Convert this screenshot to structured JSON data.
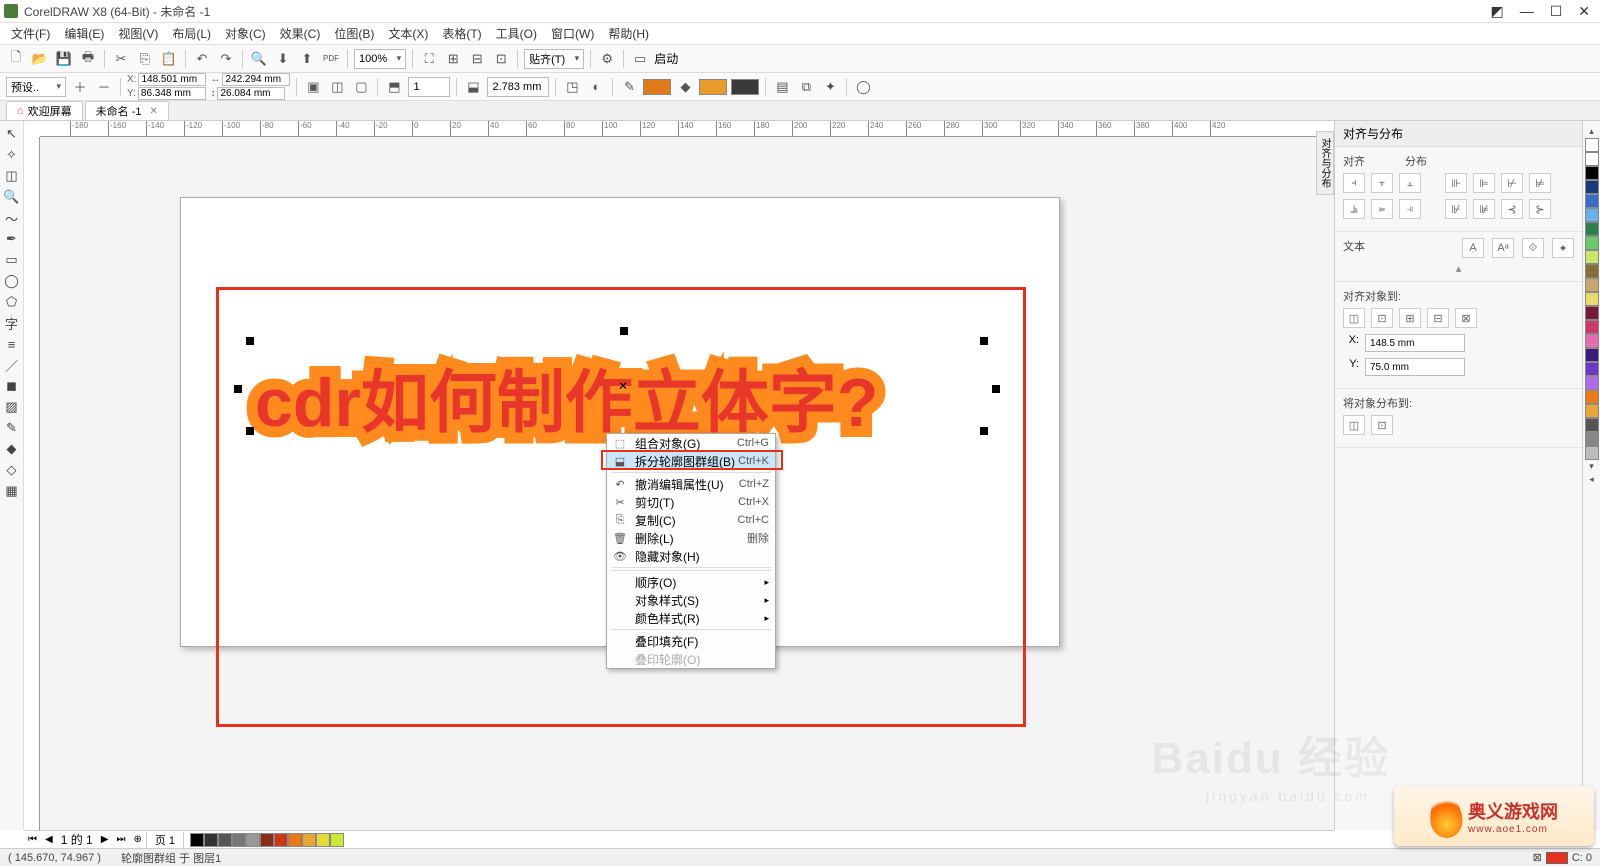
{
  "window": {
    "title": "CorelDRAW X8 (64-Bit) - 未命名 -1"
  },
  "menu": [
    "文件(F)",
    "编辑(E)",
    "视图(V)",
    "布局(L)",
    "对象(C)",
    "效果(C)",
    "位图(B)",
    "文本(X)",
    "表格(T)",
    "工具(O)",
    "窗口(W)",
    "帮助(H)"
  ],
  "toolbar1": {
    "zoom": "100%",
    "snap": "贴齐(T)",
    "launch": "启动"
  },
  "toolbar2": {
    "preset": "预设..",
    "x": "148.501 mm",
    "y": "86.348 mm",
    "w": "242.294 mm",
    "h": "26.084 mm",
    "units_val": "1",
    "outline_width": "2.783 mm",
    "fill_color": "#e07a1a",
    "fill_color2": "#e89a2a",
    "outline_color": "#3a3a3a"
  },
  "tabs": {
    "welcome": "欢迎屏幕",
    "doc": "未命名 -1"
  },
  "ruler_marks": [
    -180,
    -160,
    -140,
    -120,
    -100,
    -80,
    -60,
    -40,
    -20,
    0,
    20,
    40,
    60,
    80,
    100,
    120,
    140,
    160,
    180,
    200,
    220,
    240,
    260,
    280,
    300,
    320,
    340,
    360,
    380,
    400,
    420
  ],
  "art_text": "cdr如何制作立体字?",
  "context_menu": {
    "items": [
      {
        "icon": "⬚",
        "label": "组合对象(G)",
        "shortcut": "Ctrl+G"
      },
      {
        "icon": "⬓",
        "label": "拆分轮廓图群组(B)",
        "shortcut": "Ctrl+K",
        "selected": true
      },
      {
        "icon": "↶",
        "label": "撤消编辑属性(U)",
        "shortcut": "Ctrl+Z"
      },
      {
        "icon": "✂",
        "label": "剪切(T)",
        "shortcut": "Ctrl+X"
      },
      {
        "icon": "⎘",
        "label": "复制(C)",
        "shortcut": "Ctrl+C"
      },
      {
        "icon": "🗑",
        "label": "删除(L)",
        "shortcut": "删除"
      },
      {
        "icon": "👁",
        "label": "隐藏对象(H)",
        "shortcut": ""
      },
      {
        "label": "顺序(O)",
        "submenu": true
      },
      {
        "label": "对象样式(S)",
        "submenu": true
      },
      {
        "label": "颜色样式(R)",
        "submenu": true
      },
      {
        "label": "叠印填充(F)"
      },
      {
        "label": "叠印轮廓(O)",
        "disabled": true
      }
    ]
  },
  "docker": {
    "title": "对齐与分布",
    "sec_align": "对齐",
    "sec_distribute": "分布",
    "sec_text": "文本",
    "sec_align_to": "对齐对象到:",
    "x_val": "148.5 mm",
    "y_val": "75.0 mm",
    "sec_dist_to": "将对象分布到:",
    "vtab": "对齐与分布"
  },
  "page_nav": {
    "indicator": "1 的 1",
    "page_label": "页 1"
  },
  "status": {
    "coord": "( 145.670, 74.967 )",
    "object_info": "轮廓图群组 于 图层1",
    "fill_label": "C: 0"
  },
  "palette_colors": [
    "#ffffff",
    "#000000",
    "#1a3a7a",
    "#3a6bc9",
    "#6bb0e8",
    "#2e7d4a",
    "#6bc96b",
    "#c9e86b",
    "#8a6b3a",
    "#c9a66b",
    "#e8d96b",
    "#7a1a3a",
    "#c93a6b",
    "#e86bb0",
    "#3a1a7a",
    "#6b3ac9",
    "#b06be8",
    "#e87a1a",
    "#e8a63a",
    "#555555",
    "#888888",
    "#bbbbbb"
  ],
  "bottom_palette": [
    "#000000",
    "#333333",
    "#555555",
    "#777777",
    "#999999",
    "#8a2a1a",
    "#c93a1a",
    "#e87a1a",
    "#e8a63a",
    "#e8d93a",
    "#c9e83a"
  ],
  "watermark": {
    "main": "Baidu 经验",
    "sub": "jingyan.baidu.com"
  },
  "site_brand": {
    "cn": "奥义游戏网",
    "url": "www.aoe1.com"
  }
}
